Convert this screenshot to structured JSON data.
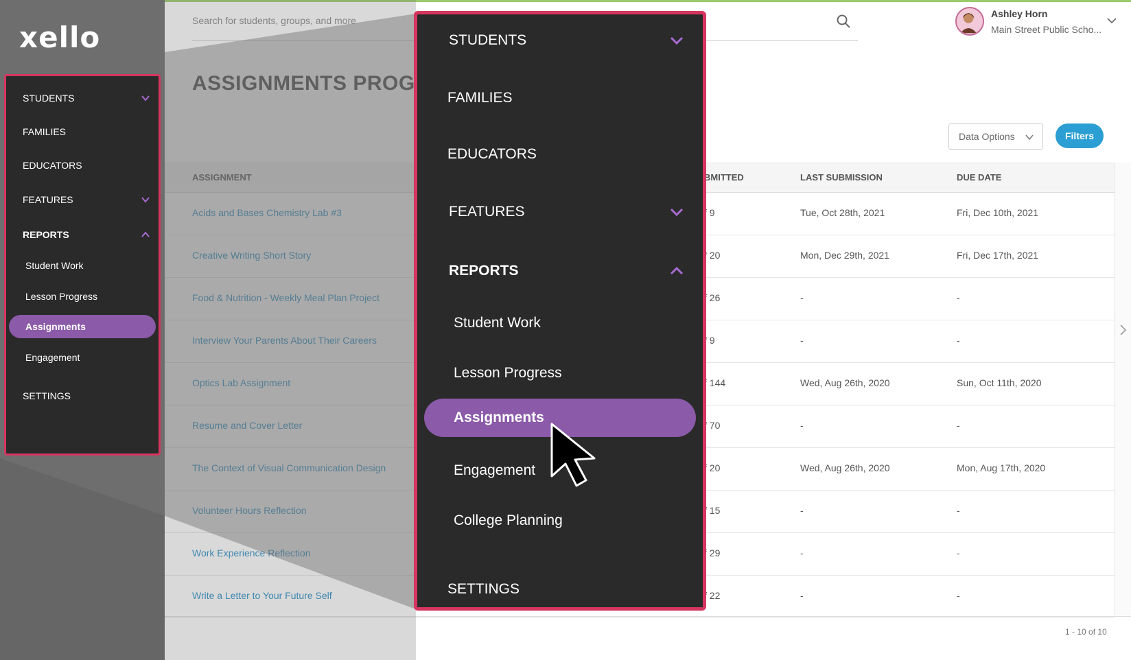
{
  "app": {
    "logo": "xello"
  },
  "search": {
    "placeholder": "Search for students, groups, and more"
  },
  "user": {
    "name": "Ashley Horn",
    "school": "Main Street Public Scho..."
  },
  "page": {
    "title": "ASSIGNMENTS PROGR"
  },
  "toolbar": {
    "data_options": "Data Options",
    "filters": "Filters"
  },
  "sidebar": {
    "items": [
      {
        "label": "STUDENTS"
      },
      {
        "label": "FAMILIES"
      },
      {
        "label": "EDUCATORS"
      },
      {
        "label": "FEATURES"
      },
      {
        "label": "REPORTS"
      },
      {
        "label": "Student Work"
      },
      {
        "label": "Lesson Progress"
      },
      {
        "label": "Assignments"
      },
      {
        "label": "Engagement"
      },
      {
        "label": "SETTINGS"
      }
    ]
  },
  "zoom_menu": {
    "items": [
      {
        "label": "STUDENTS"
      },
      {
        "label": "FAMILIES"
      },
      {
        "label": "EDUCATORS"
      },
      {
        "label": "FEATURES"
      },
      {
        "label": "REPORTS"
      },
      {
        "label": "Student Work"
      },
      {
        "label": "Lesson Progress"
      },
      {
        "label": "Assignments"
      },
      {
        "label": "Engagement"
      },
      {
        "label": "College Planning"
      },
      {
        "label": "SETTINGS"
      }
    ]
  },
  "table": {
    "columns": [
      "ASSIGNMENT",
      "BMITTED",
      "LAST SUBMISSION",
      "DUE DATE"
    ],
    "rows": [
      {
        "assignment": "Acids and Bases Chemistry Lab #3",
        "submitted": "f 9",
        "last": "Tue, Oct 28th, 2021",
        "due": "Fri, Dec 10th, 2021"
      },
      {
        "assignment": "Creative Writing Short Story",
        "submitted": "f 20",
        "last": "Mon, Dec 29th, 2021",
        "due": "Fri, Dec 17th, 2021"
      },
      {
        "assignment": "Food & Nutrition - Weekly Meal Plan Project",
        "submitted": "f 26",
        "last": "-",
        "due": "-"
      },
      {
        "assignment": "Interview Your Parents About Their Careers",
        "submitted": "f 9",
        "last": "-",
        "due": "-"
      },
      {
        "assignment": "Optics Lab Assignment",
        "submitted": "f 144",
        "last": "Wed, Aug 26th, 2020",
        "due": "Sun, Oct 11th, 2020"
      },
      {
        "assignment": "Resume and Cover Letter",
        "submitted": "f 70",
        "last": "-",
        "due": "-"
      },
      {
        "assignment": "The Context of Visual Communication Design",
        "submitted": "f 20",
        "last": "Wed, Aug 26th, 2020",
        "due": "Mon, Aug 17th, 2020"
      },
      {
        "assignment": "Volunteer Hours Reflection",
        "submitted": "f 15",
        "last": "-",
        "due": "-"
      },
      {
        "assignment": "Work Experience Reflection",
        "submitted": "f 29",
        "last": "-",
        "due": "-"
      },
      {
        "assignment": "Write a Letter to Your Future Self",
        "submitted": "f 22",
        "last": "-",
        "due": "-"
      }
    ]
  },
  "pagination": {
    "text": "1 - 10 of 10"
  },
  "colors": {
    "accent_purple": "#8b5aa8",
    "highlight_border": "#d6355f",
    "link_blue": "#2b8fc7",
    "filters_blue": "#2b9fd3"
  },
  "icons": [
    "search-icon",
    "chevron-down-icon",
    "chevron-up-icon",
    "chevron-right-icon",
    "cursor-arrow-icon",
    "avatar"
  ]
}
